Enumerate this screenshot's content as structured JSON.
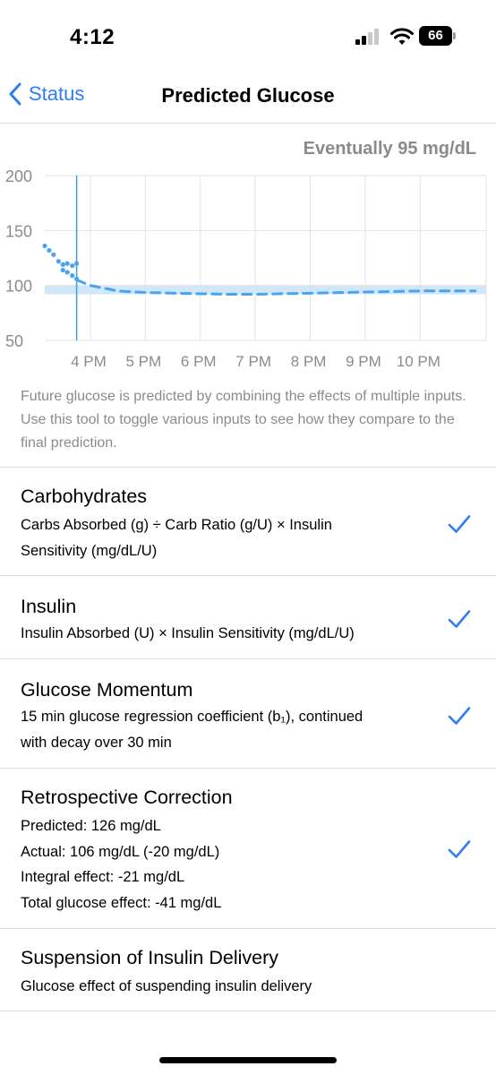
{
  "status_bar": {
    "time": "4:12",
    "battery": "66"
  },
  "nav": {
    "back_label": "Status",
    "title": "Predicted Glucose"
  },
  "chart_header": {
    "eventually": "Eventually 95 mg/dL"
  },
  "chart_data": {
    "type": "line",
    "title": "",
    "xlabel": "",
    "ylabel": "",
    "x_tick_labels": [
      "4 PM",
      "5 PM",
      "6 PM",
      "7 PM",
      "8 PM",
      "9 PM",
      "10 PM"
    ],
    "y_tick_labels": [
      "200",
      "150",
      "100",
      "50"
    ],
    "ylim": [
      50,
      200
    ],
    "x_unit": "hours after 12 PM",
    "xlim": [
      3.17,
      11.2
    ],
    "now": 3.75,
    "correction_range": [
      92,
      100
    ],
    "grid": true,
    "series": [
      {
        "style": "dots",
        "color": "#4aa3f0",
        "x": [
          3.17,
          3.25,
          3.33,
          3.42,
          3.5,
          3.58,
          3.67,
          3.75
        ],
        "y": [
          136,
          132,
          128,
          122,
          119,
          120,
          118,
          120
        ]
      },
      {
        "style": "dots",
        "color": "#4aa3f0",
        "x": [
          3.5,
          3.58,
          3.67,
          3.75
        ],
        "y": [
          114,
          112,
          109,
          106
        ]
      },
      {
        "style": "dashed",
        "color": "#4aa3f0",
        "x": [
          3.75,
          4.0,
          4.5,
          4.8,
          5.5,
          6.5,
          7.0,
          8.0,
          9.0,
          10.0,
          11.0
        ],
        "y": [
          105,
          100,
          95,
          94,
          93,
          92,
          92,
          93,
          94,
          95,
          95
        ]
      }
    ]
  },
  "description": "Future glucose is predicted by combining the effects of multiple inputs. Use this tool to toggle various inputs to see how they compare to the final prediction.",
  "inputs": [
    {
      "title": "Carbohydrates",
      "lines": [
        "Carbs Absorbed (g) ÷ Carb Ratio (g/U) × Insulin",
        "Sensitivity (mg/dL/U)"
      ],
      "checked": true
    },
    {
      "title": "Insulin",
      "lines": [
        "Insulin Absorbed (U) × Insulin Sensitivity (mg/dL/U)"
      ],
      "checked": true
    },
    {
      "title": "Glucose Momentum",
      "lines": [
        "15 min glucose regression coefficient (b₁), continued",
        "with decay over 30 min"
      ],
      "checked": true
    },
    {
      "title": "Retrospective Correction",
      "lines": [
        "Predicted: 126 mg/dL",
        "Actual: 106 mg/dL (-20 mg/dL)",
        "Integral effect: -21 mg/dL",
        "Total glucose effect: -41 mg/dL"
      ],
      "checked": true
    },
    {
      "title": "Suspension of Insulin Delivery",
      "lines": [
        "Glucose effect of suspending insulin delivery"
      ],
      "checked": false
    }
  ],
  "colors": {
    "accent": "#2f7cf6",
    "glucose": "#4aa3f0",
    "range": "#cfe7fa",
    "now_line": "#3d9be9"
  }
}
